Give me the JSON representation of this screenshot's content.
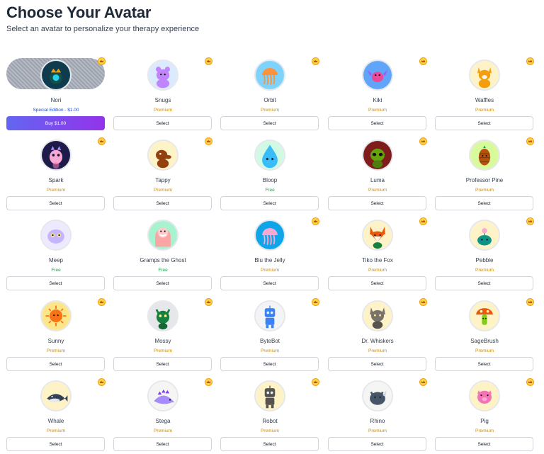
{
  "header": {
    "title": "Choose Your Avatar",
    "subtitle": "Select an avatar to personalize your therapy experience"
  },
  "colors": {
    "premium": "#ca8a04",
    "free": "#16a34a",
    "special": "#1d4ed8",
    "buy_gradient_start": "#6366f1",
    "buy_gradient_end": "#9333ea"
  },
  "avatars": [
    {
      "name": "Nori",
      "tier": "Special Edition - $1.00",
      "button": "Buy $1.00",
      "crown": true,
      "kind": "special",
      "icon": "crown-fish-icon",
      "bg": "#0f3b4f",
      "fg": "#f59e0b"
    },
    {
      "name": "Snugs",
      "tier": "Premium",
      "button": "Select",
      "crown": true,
      "kind": "premium",
      "icon": "bear-icon",
      "bg": "#dbeafe",
      "fg": "#c084fc"
    },
    {
      "name": "Orbit",
      "tier": "Premium",
      "button": "Select",
      "crown": true,
      "kind": "premium",
      "icon": "jellyfish-icon",
      "bg": "#7dd3fc",
      "fg": "#fb923c"
    },
    {
      "name": "Kiki",
      "tier": "Premium",
      "button": "Select",
      "crown": true,
      "kind": "premium",
      "icon": "bird-icon",
      "bg": "#60a5fa",
      "fg": "#ec4899"
    },
    {
      "name": "Waffles",
      "tier": "Premium",
      "button": "Select",
      "crown": true,
      "kind": "premium",
      "icon": "corgi-icon",
      "bg": "#fef3c7",
      "fg": "#f59e0b"
    },
    {
      "name": "Spark",
      "tier": "Premium",
      "button": "Select",
      "crown": true,
      "kind": "premium",
      "icon": "creature-icon",
      "bg": "#1e1b4b",
      "fg": "#f9a8d4"
    },
    {
      "name": "Tappy",
      "tier": "Premium",
      "button": "Select",
      "crown": true,
      "kind": "premium",
      "icon": "tapir-icon",
      "bg": "#fef3c7",
      "fg": "#92400e"
    },
    {
      "name": "Bloop",
      "tier": "Free",
      "button": "Select",
      "crown": false,
      "kind": "free",
      "icon": "water-drop-icon",
      "bg": "#d1fae5",
      "fg": "#38bdf8"
    },
    {
      "name": "Luma",
      "tier": "Premium",
      "button": "Select",
      "crown": true,
      "kind": "premium",
      "icon": "alien-icon",
      "bg": "#7f1d1d",
      "fg": "#65a30d"
    },
    {
      "name": "Professor Pine",
      "tier": "Premium",
      "button": "Select",
      "crown": true,
      "kind": "premium",
      "icon": "pinecone-icon",
      "bg": "#d9f99d",
      "fg": "#b45309"
    },
    {
      "name": "Meep",
      "tier": "Free",
      "button": "Select",
      "crown": false,
      "kind": "free",
      "icon": "blob-icon",
      "bg": "#ede9fe",
      "fg": "#c4b5fd"
    },
    {
      "name": "Gramps the Ghost",
      "tier": "Free",
      "button": "Select",
      "crown": false,
      "kind": "free",
      "icon": "ghost-icon",
      "bg": "#a7f3d0",
      "fg": "#fca5a5"
    },
    {
      "name": "Blu the Jelly",
      "tier": "Premium",
      "button": "Select",
      "crown": true,
      "kind": "premium",
      "icon": "jellyfish-icon",
      "bg": "#0ea5e9",
      "fg": "#f9a8d4"
    },
    {
      "name": "Tiko the Fox",
      "tier": "Premium",
      "button": "Select",
      "crown": true,
      "kind": "premium",
      "icon": "fox-icon",
      "bg": "#fef3c7",
      "fg": "#ea580c"
    },
    {
      "name": "Pebble",
      "tier": "Premium",
      "button": "Select",
      "crown": true,
      "kind": "premium",
      "icon": "pebble-icon",
      "bg": "#fef3c7",
      "fg": "#0d9488"
    },
    {
      "name": "Sunny",
      "tier": "Premium",
      "button": "Select",
      "crown": true,
      "kind": "premium",
      "icon": "sun-icon",
      "bg": "#fde68a",
      "fg": "#f97316"
    },
    {
      "name": "Mossy",
      "tier": "Premium",
      "button": "Select",
      "crown": true,
      "kind": "premium",
      "icon": "moss-creature-icon",
      "bg": "#e5e7eb",
      "fg": "#15803d"
    },
    {
      "name": "ByteBot",
      "tier": "Premium",
      "button": "Select",
      "crown": true,
      "kind": "premium",
      "icon": "robot-icon",
      "bg": "#f3f4f6",
      "fg": "#3b82f6"
    },
    {
      "name": "Dr. Whiskers",
      "tier": "Premium",
      "button": "Select",
      "crown": true,
      "kind": "premium",
      "icon": "cat-icon",
      "bg": "#fef3c7",
      "fg": "#78716c"
    },
    {
      "name": "SageBrush",
      "tier": "Premium",
      "button": "Select",
      "crown": true,
      "kind": "premium",
      "icon": "mushroom-icon",
      "bg": "#fef3c7",
      "fg": "#ea580c"
    },
    {
      "name": "Whale",
      "tier": "Premium",
      "button": "Select",
      "crown": true,
      "kind": "premium",
      "icon": "whale-icon",
      "bg": "#fef3c7",
      "fg": "#334155"
    },
    {
      "name": "Stega",
      "tier": "Premium",
      "button": "Select",
      "crown": true,
      "kind": "premium",
      "icon": "dinosaur-icon",
      "bg": "#f5f5f4",
      "fg": "#a78bfa"
    },
    {
      "name": "Robot",
      "tier": "Premium",
      "button": "Select",
      "crown": true,
      "kind": "premium",
      "icon": "robot-icon",
      "bg": "#fef3c7",
      "fg": "#57534e"
    },
    {
      "name": "Rhino",
      "tier": "Premium",
      "button": "Select",
      "crown": true,
      "kind": "premium",
      "icon": "rhino-icon",
      "bg": "#f5f5f4",
      "fg": "#475569"
    },
    {
      "name": "Pig",
      "tier": "Premium",
      "button": "Select",
      "crown": true,
      "kind": "premium",
      "icon": "pig-icon",
      "bg": "#fef3c7",
      "fg": "#f472b6"
    }
  ]
}
